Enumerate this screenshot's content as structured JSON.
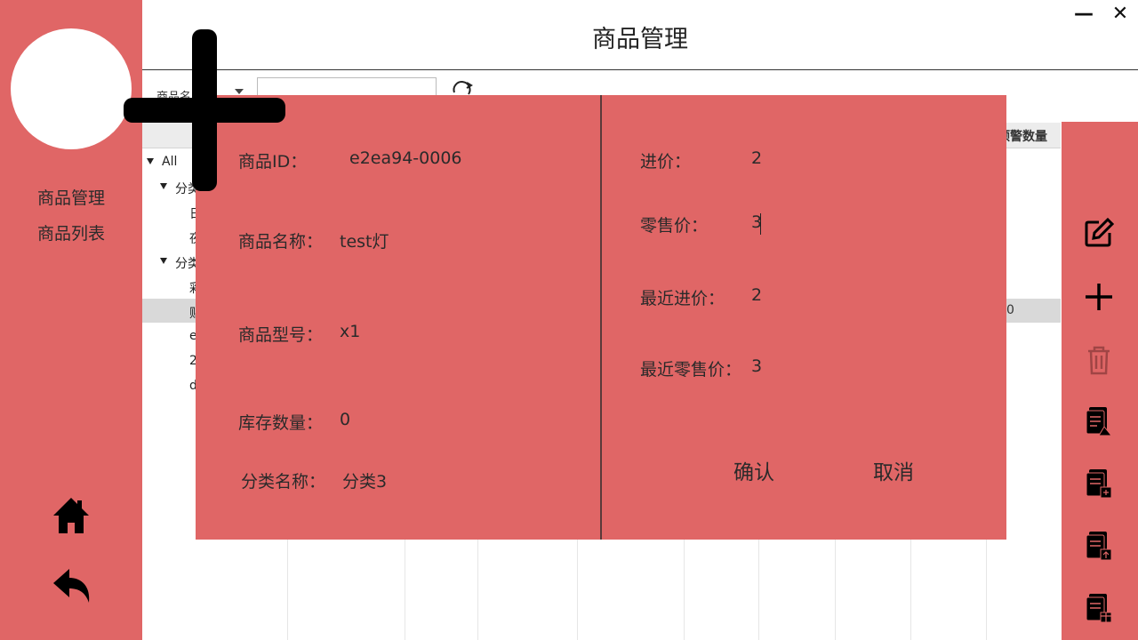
{
  "window": {
    "title": "商品管理",
    "minimize_glyph": "—",
    "close_glyph": "✕"
  },
  "sidebar": {
    "items": [
      {
        "label": "商品管理"
      },
      {
        "label": "商品列表"
      }
    ],
    "home_icon": "home-icon",
    "back_icon": "reply-arrow-icon"
  },
  "filter": {
    "label": "商品名",
    "search_value": "",
    "refresh_icon": "refresh-icon"
  },
  "tree": {
    "rows": [
      {
        "text": "All",
        "expanded": true
      },
      {
        "text": "分类",
        "expanded": true
      },
      {
        "text": "日"
      },
      {
        "text": "夜"
      },
      {
        "text": "分类",
        "expanded": true
      },
      {
        "text": "彩"
      },
      {
        "text": "贴"
      },
      {
        "text": "e"
      },
      {
        "text": "2"
      },
      {
        "text": "d"
      }
    ]
  },
  "table": {
    "last_column_header": "预警数量",
    "selected_row_last_value": "0"
  },
  "dialog": {
    "left": [
      {
        "label": "商品ID：",
        "value": "e2ea94-0006"
      },
      {
        "label": "商品名称：",
        "value": "test灯"
      },
      {
        "label": "商品型号：",
        "value": "x1"
      },
      {
        "label": "库存数量：",
        "value": "0"
      },
      {
        "label": "分类名称：",
        "value": "分类3"
      }
    ],
    "right": [
      {
        "label": "进价：",
        "value": "2"
      },
      {
        "label": "零售价：",
        "value": "3"
      },
      {
        "label": "最近进价：",
        "value": "2"
      },
      {
        "label": "最近零售价：",
        "value": "3"
      }
    ],
    "confirm_label": "确认",
    "cancel_label": "取消"
  },
  "toolbar": {
    "icons": [
      "edit-icon",
      "add-icon",
      "delete-icon",
      "export-doc-icon",
      "import-doc-icon",
      "upload-doc-icon",
      "gift-doc-icon"
    ]
  },
  "colors": {
    "accent": "#e06666",
    "dialog_bg": "#e06666",
    "overlay_cross": "#000000"
  }
}
